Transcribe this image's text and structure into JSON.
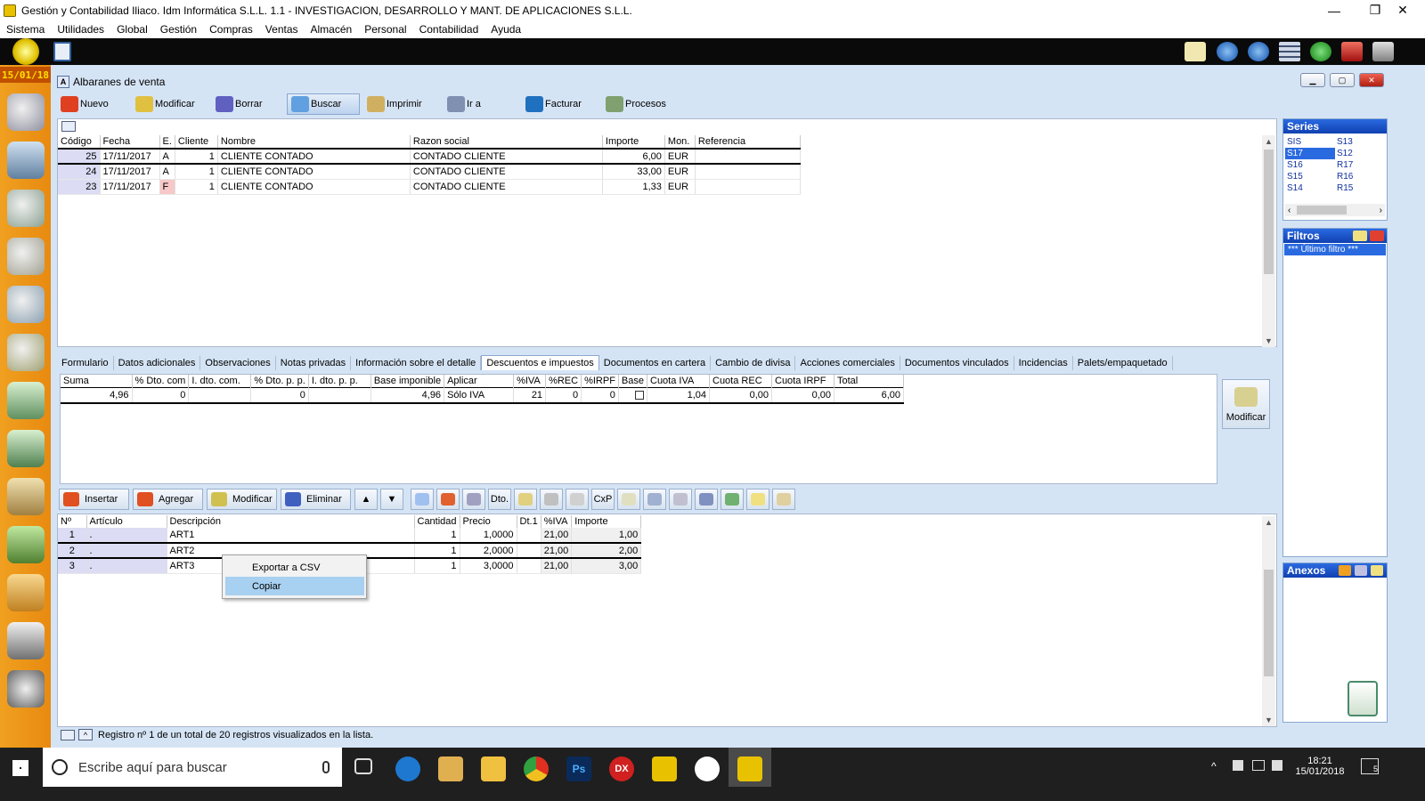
{
  "window": {
    "title": "Gestión y Contabilidad Iliaco. Idm Informática S.L.L. 1.1 - INVESTIGACION, DESARROLLO Y MANT. DE APLICACIONES S.L.L.",
    "minimize": "—",
    "maximize": "❐",
    "close": "✕"
  },
  "menu": [
    "Sistema",
    "Utilidades",
    "Global",
    "Gestión",
    "Compras",
    "Ventas",
    "Almacén",
    "Personal",
    "Contabilidad",
    "Ayuda"
  ],
  "sidebar": {
    "date": "15/01/18"
  },
  "doc": {
    "title": "Albaranes de venta",
    "title_prefix": "A"
  },
  "toolbar": [
    {
      "label": "Nuevo",
      "icon": "new-icon",
      "color": "#e04020"
    },
    {
      "label": "Modificar",
      "icon": "edit-icon",
      "color": "#e0c040"
    },
    {
      "label": "Borrar",
      "icon": "delete-icon",
      "color": "#6060c0"
    },
    {
      "label": "Buscar",
      "icon": "search-icon",
      "color": "#60a0e0"
    },
    {
      "label": "Imprimir",
      "icon": "print-icon",
      "color": "#d0b060"
    },
    {
      "label": "Ir a",
      "icon": "goto-icon",
      "color": "#8090b0"
    },
    {
      "label": "Facturar",
      "icon": "invoice-icon",
      "color": "#2070c0"
    },
    {
      "label": "Procesos",
      "icon": "gears-icon",
      "color": "#80a070"
    }
  ],
  "albaranes": {
    "headers": [
      "Código",
      "Fecha",
      "E.",
      "Cliente",
      "Nombre",
      "Razon social",
      "Importe",
      "Mon.",
      "Referencia"
    ],
    "rows": [
      [
        "25",
        "17/11/2017",
        "A",
        "1",
        "CLIENTE CONTADO",
        "CONTADO CLIENTE",
        "6,00",
        "EUR",
        ""
      ],
      [
        "24",
        "17/11/2017",
        "A",
        "1",
        "CLIENTE CONTADO",
        "CONTADO CLIENTE",
        "33,00",
        "EUR",
        ""
      ],
      [
        "23",
        "17/11/2017",
        "F",
        "1",
        "CLIENTE CONTADO",
        "CONTADO CLIENTE",
        "1,33",
        "EUR",
        ""
      ]
    ]
  },
  "series": {
    "title": "Series",
    "items": [
      [
        "SIS",
        "S13"
      ],
      [
        "S17",
        "S12"
      ],
      [
        "S16",
        "R17"
      ],
      [
        "S15",
        "R16"
      ],
      [
        "S14",
        "R15"
      ]
    ],
    "selected": "S17"
  },
  "filtros": {
    "title": "Filtros",
    "item": "*** Último filtro ***"
  },
  "anexos": {
    "title": "Anexos"
  },
  "tabs": [
    "Formulario",
    "Datos adicionales",
    "Observaciones",
    "Notas privadas",
    "Información sobre el detalle",
    "Descuentos e impuestos",
    "Documentos en cartera",
    "Cambio de divisa",
    "Acciones comerciales",
    "Documentos vinculados",
    "Incidencias",
    "Palets/empaquetado"
  ],
  "selected_tab": "Descuentos e impuestos",
  "taxes": {
    "headers": [
      "Suma",
      "% Dto. com",
      "I. dto. com.",
      "% Dto. p. p.",
      "I. dto. p. p.",
      "Base imponible",
      "Aplicar",
      "%IVA",
      "%REC",
      "%IRPF",
      "Base",
      "Cuota IVA",
      "Cuota REC",
      "Cuota IRPF",
      "Total"
    ],
    "row": [
      "4,96",
      "0",
      "",
      "0",
      "",
      "4,96",
      "Sólo IVA",
      "21",
      "0",
      "0",
      "",
      "1,04",
      "0,00",
      "0,00",
      "6,00"
    ]
  },
  "tax_modify_label": "Modificar",
  "detail_buttons": [
    {
      "label": "Insertar",
      "color": "#e05020"
    },
    {
      "label": "Agregar",
      "color": "#e05020"
    },
    {
      "label": "Modificar",
      "color": "#d0c050"
    },
    {
      "label": "Eliminar",
      "color": "#4060c0"
    }
  ],
  "detail_small": [
    "▲",
    "▼",
    "",
    "",
    "",
    "Dto.",
    "",
    "",
    "",
    "CxP",
    "",
    "",
    "",
    "",
    "",
    "",
    ""
  ],
  "detail": {
    "headers": [
      "Nº",
      "Artículo",
      "Descripción",
      "Cantidad",
      "Precio",
      "Dt.1",
      "%IVA",
      "Importe"
    ],
    "rows": [
      [
        "1",
        ".",
        "ART1",
        "1",
        "1,0000",
        "",
        "21,00",
        "1,00"
      ],
      [
        "2",
        ".",
        "ART2",
        "1",
        "2,0000",
        "",
        "21,00",
        "2,00"
      ],
      [
        "3",
        ".",
        "ART3",
        "1",
        "3,0000",
        "",
        "21,00",
        "3,00"
      ]
    ]
  },
  "context_menu": {
    "items": [
      "Exportar a CSV",
      "Copiar"
    ],
    "highlighted": "Copiar"
  },
  "status": "Registro nº 1 de un total de 20 registros visualizados en la lista.",
  "taskbar": {
    "search_placeholder": "Escribe aquí para buscar",
    "time": "18:21",
    "date": "15/01/2018",
    "notifications": "5",
    "dx_label": "DX",
    "ps_label": "Ps"
  }
}
